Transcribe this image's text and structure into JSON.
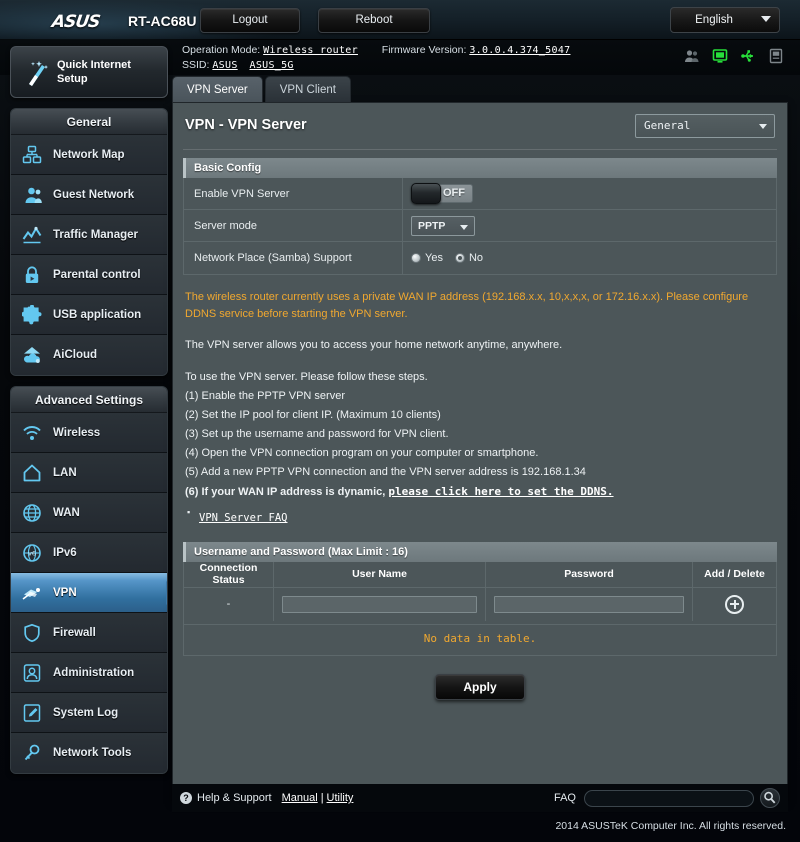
{
  "header": {
    "brand": "ASUS",
    "model": "RT-AC68U",
    "logout_label": "Logout",
    "reboot_label": "Reboot",
    "language": "English"
  },
  "info": {
    "operation_mode_label": "Operation Mode:",
    "operation_mode_value": "Wireless router",
    "firmware_label": "Firmware Version:",
    "firmware_value": "3.0.0.4.374_5047",
    "ssid_label": "SSID:",
    "ssid_1": "ASUS",
    "ssid_2": "ASUS_5G",
    "status_icons": [
      "users-icon",
      "monitor-icon",
      "usb-icon",
      "printer-icon"
    ]
  },
  "sidebar": {
    "quick_setup": "Quick Internet Setup",
    "general_header": "General",
    "general_items": [
      {
        "label": "Network Map",
        "icon": "network-map-icon"
      },
      {
        "label": "Guest Network",
        "icon": "guest-network-icon"
      },
      {
        "label": "Traffic Manager",
        "icon": "traffic-manager-icon"
      },
      {
        "label": "Parental control",
        "icon": "lock-icon"
      },
      {
        "label": "USB application",
        "icon": "puzzle-icon"
      },
      {
        "label": "AiCloud",
        "icon": "cloud-icon"
      }
    ],
    "advanced_header": "Advanced Settings",
    "advanced_items": [
      {
        "label": "Wireless",
        "icon": "wifi-icon"
      },
      {
        "label": "LAN",
        "icon": "home-icon"
      },
      {
        "label": "WAN",
        "icon": "globe-icon"
      },
      {
        "label": "IPv6",
        "icon": "ipv6-globe-icon"
      },
      {
        "label": "VPN",
        "icon": "vpn-key-icon"
      },
      {
        "label": "Firewall",
        "icon": "shield-icon"
      },
      {
        "label": "Administration",
        "icon": "user-icon"
      },
      {
        "label": "System Log",
        "icon": "log-edit-icon"
      },
      {
        "label": "Network Tools",
        "icon": "wrench-icon"
      }
    ],
    "active_item": "VPN"
  },
  "main": {
    "tabs": [
      {
        "label": "VPN Server",
        "active": true
      },
      {
        "label": "VPN Client",
        "active": false
      }
    ],
    "page_title": "VPN - VPN Server",
    "mode_select": "General",
    "basic_config_header": "Basic Config",
    "fields": {
      "enable_label": "Enable VPN Server",
      "enable_state": "OFF",
      "server_mode_label": "Server mode",
      "server_mode_value": "PPTP",
      "samba_label": "Network Place (Samba) Support",
      "samba_yes": "Yes",
      "samba_no": "No",
      "samba_selected": "No"
    },
    "warning": "The wireless router currently uses a private WAN IP address (192.168.x.x, 10,x,x,x, or 172.16.x.x). Please configure DDNS service before starting the VPN server.",
    "description": "The VPN server allows you to access your home network anytime, anywhere.",
    "steps_intro": "To use the VPN server. Please follow these steps.",
    "steps": [
      "(1) Enable the PPTP VPN server",
      "(2) Set the IP pool for client IP. (Maximum 10 clients)",
      "(3) Set up the username and password for VPN client.",
      "(4) Open the VPN connection program on your computer or smartphone.",
      "(5) Add a new PPTP VPN connection and the VPN server address is 192.168.1.34"
    ],
    "step6_prefix": "(6) If your WAN IP address is dynamic, ",
    "step6_link": "please click here to set the DDNS.",
    "faq_link": "VPN Server FAQ",
    "table": {
      "header": "Username and Password (Max Limit : 16)",
      "columns": [
        "Connection Status",
        "User Name",
        "Password",
        "Add / Delete"
      ],
      "row": {
        "status": "-",
        "username_value": "",
        "password_value": ""
      },
      "empty_message": "No data in table."
    },
    "apply_label": "Apply"
  },
  "footer": {
    "help_icon": "question-icon",
    "help_label": "Help & Support",
    "manual_label": "Manual",
    "separator": "|",
    "utility_label": "Utility",
    "faq_label": "FAQ",
    "faq_value": "",
    "search_icon": "search-icon",
    "copyright": "2014 ASUSTeK Computer Inc. All rights reserved."
  }
}
